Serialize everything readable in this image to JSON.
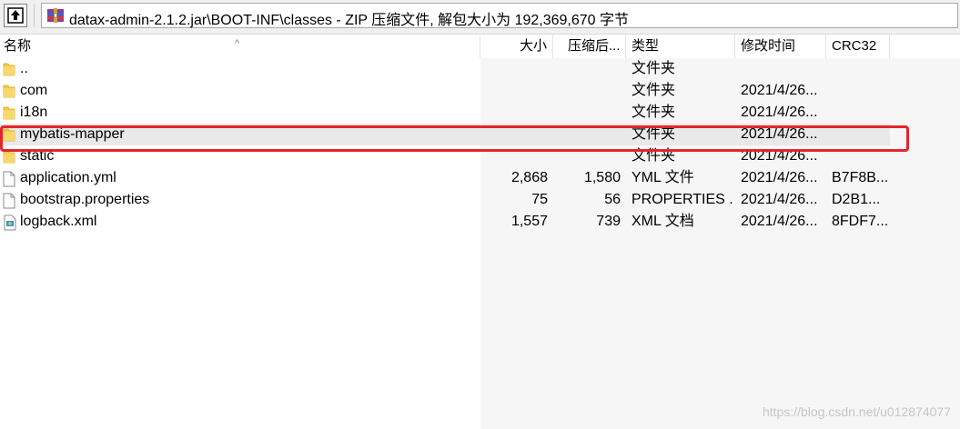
{
  "pathbar": {
    "path": "datax-admin-2.1.2.jar\\BOOT-INF\\classes - ZIP 压缩文件, 解包大小为 192,369,670 字节"
  },
  "columns": {
    "name": "名称",
    "size": "大小",
    "packed": "压缩后...",
    "type": "类型",
    "modified": "修改时间",
    "crc": "CRC32"
  },
  "rows": [
    {
      "icon": "folder-icon",
      "name": "..",
      "size": "",
      "packed": "",
      "type": "文件夹",
      "modified": "",
      "crc": ""
    },
    {
      "icon": "folder-icon",
      "name": "com",
      "size": "",
      "packed": "",
      "type": "文件夹",
      "modified": "2021/4/26...",
      "crc": ""
    },
    {
      "icon": "folder-icon",
      "name": "i18n",
      "size": "",
      "packed": "",
      "type": "文件夹",
      "modified": "2021/4/26...",
      "crc": ""
    },
    {
      "icon": "folder-icon",
      "name": "mybatis-mapper",
      "size": "",
      "packed": "",
      "type": "文件夹",
      "modified": "2021/4/26...",
      "crc": ""
    },
    {
      "icon": "folder-icon",
      "name": "static",
      "size": "",
      "packed": "",
      "type": "文件夹",
      "modified": "2021/4/26...",
      "crc": ""
    },
    {
      "icon": "file-icon",
      "name": "application.yml",
      "size": "2,868",
      "packed": "1,580",
      "type": "YML 文件",
      "modified": "2021/4/26...",
      "crc": "B7F8B..."
    },
    {
      "icon": "file-icon",
      "name": "bootstrap.properties",
      "size": "75",
      "packed": "56",
      "type": "PROPERTIES ...",
      "modified": "2021/4/26...",
      "crc": "D2B1..."
    },
    {
      "icon": "xml-file-icon",
      "name": "logback.xml",
      "size": "1,557",
      "packed": "739",
      "type": "XML 文档",
      "modified": "2021/4/26...",
      "crc": "8FDF7..."
    }
  ],
  "watermark": "https://blog.csdn.net/u012874077",
  "colors": {
    "highlight": "#e8242b",
    "folder": "#f2c84b",
    "selected_row": "#e9e9e9"
  }
}
